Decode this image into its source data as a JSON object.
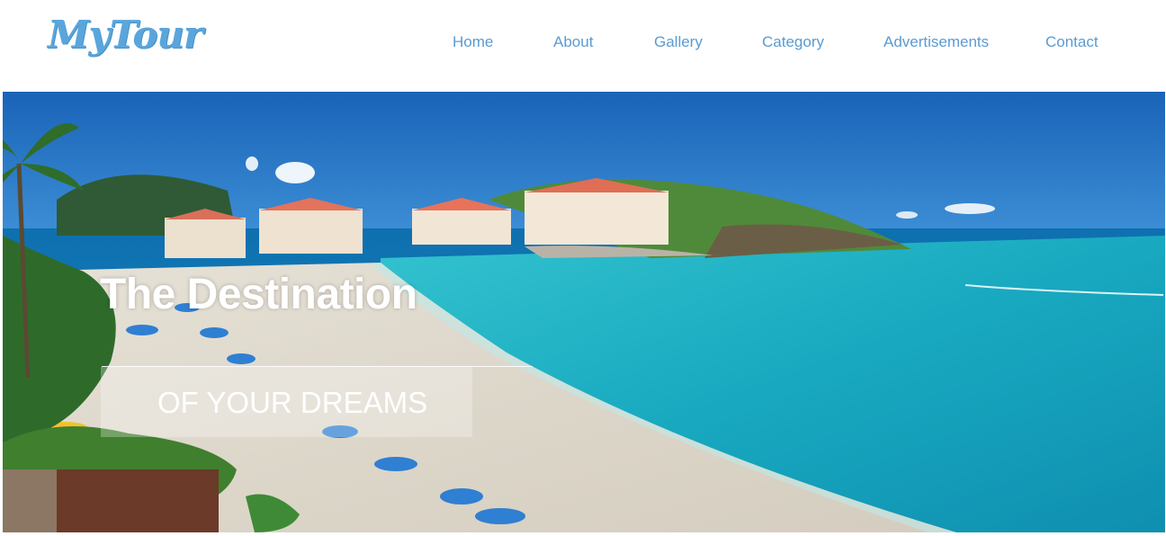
{
  "brand": {
    "logo_text": "MyTour"
  },
  "nav": {
    "items": [
      {
        "label": "Home"
      },
      {
        "label": "About"
      },
      {
        "label": "Gallery"
      },
      {
        "label": "Category"
      },
      {
        "label": "Advertisements"
      },
      {
        "label": "Contact"
      }
    ]
  },
  "hero": {
    "headline": "The Destination",
    "subheadline": "OF YOUR DREAMS"
  },
  "colors": {
    "brand": "#5aa6dc",
    "nav_link": "#5b9bd1",
    "sky": "#1d6fc4",
    "sea": "#1fb3c6"
  }
}
